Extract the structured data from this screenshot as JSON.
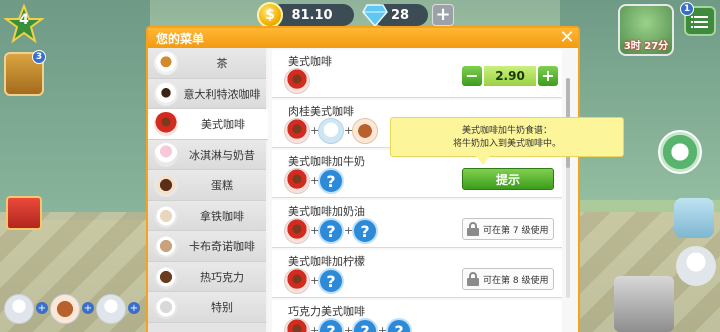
{
  "hud": {
    "level": "4",
    "coins": "81.10",
    "gems": "28",
    "book_badge": "3",
    "timer": "3时 27分",
    "menu_badge": "1"
  },
  "menu": {
    "title": "您的菜单",
    "categories": [
      {
        "label": "茶",
        "icon": "tea-cup-icon"
      },
      {
        "label": "意大利特浓咖啡",
        "icon": "espresso-cup-icon"
      },
      {
        "label": "美式咖啡",
        "icon": "americano-cup-icon",
        "active": true
      },
      {
        "label": "冰淇淋与奶昔",
        "icon": "ice-cream-icon"
      },
      {
        "label": "蛋糕",
        "icon": "cake-icon"
      },
      {
        "label": "拿铁咖啡",
        "icon": "latte-glass-icon"
      },
      {
        "label": "卡布奇诺咖啡",
        "icon": "cappuccino-glass-icon"
      },
      {
        "label": "热巧克力",
        "icon": "hot-chocolate-icon"
      },
      {
        "label": "特别",
        "icon": "special-icon"
      }
    ],
    "recipes": [
      {
        "name": "美式咖啡",
        "qty": "2.90"
      },
      {
        "name": "肉桂美式咖啡"
      },
      {
        "name": "美式咖啡加牛奶",
        "hint_label": "提示"
      },
      {
        "name": "美式咖啡加奶油",
        "locked_label": "可在第 7 级使用"
      },
      {
        "name": "美式咖啡加柠檬",
        "locked_label": "可在第 8 级使用"
      },
      {
        "name": "巧克力美式咖啡"
      }
    ],
    "tooltip_line1": "美式咖啡加牛奶食谱：",
    "tooltip_line2": "将牛奶加入到美式咖啡中。",
    "question_mark": "?",
    "plus": "+",
    "minus": "−",
    "close": "✕"
  },
  "colors": {
    "accent": "#f6a21a",
    "green_button": "#3d9c1d",
    "tooltip_bg": "#fdf59a"
  }
}
